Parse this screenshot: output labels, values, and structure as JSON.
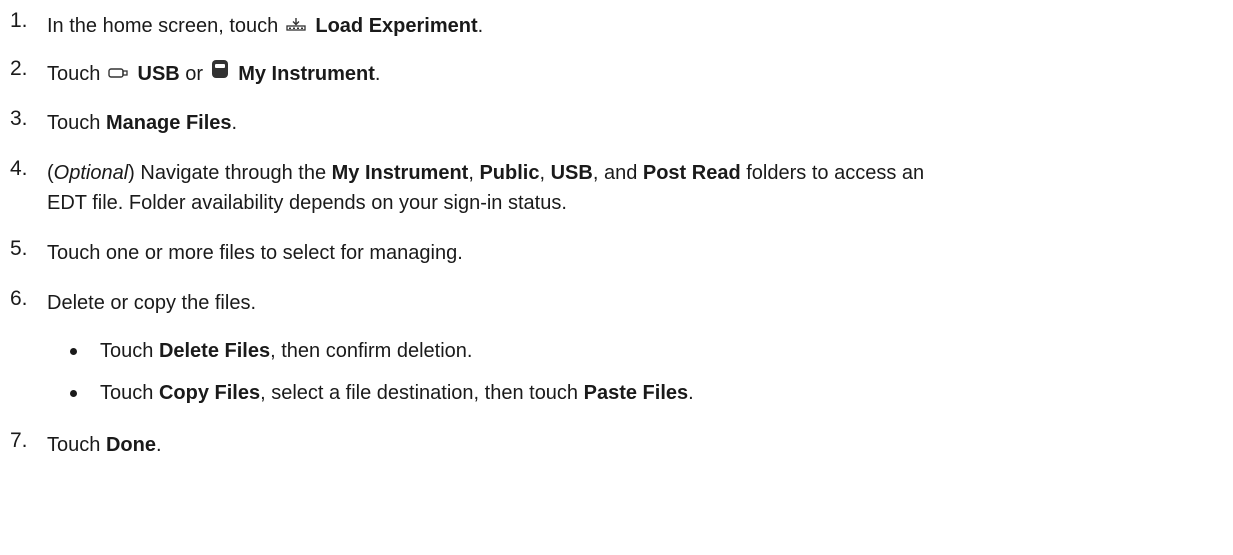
{
  "steps": [
    {
      "num": "1.",
      "pre": "In the home screen, touch",
      "icon": "load-experiment-icon",
      "bold1": "Load Experiment",
      "post": "."
    },
    {
      "num": "2.",
      "pre": "Touch",
      "icon1": "usb-icon",
      "bold1": "USB",
      "mid": "or",
      "icon2": "instrument-icon",
      "bold2": "My Instrument",
      "post": "."
    },
    {
      "num": "3.",
      "pre": "Touch",
      "bold1": "Manage Files",
      "post": "."
    },
    {
      "num": "4.",
      "open": "(",
      "ital": "Optional",
      "close": ") Navigate through the",
      "bold1": "My Instrument",
      "sep1": ",",
      "bold2": "Public",
      "sep2": ",",
      "bold3": "USB",
      "sep3": ", and",
      "bold4": "Post Read",
      "post1": "folders to access an",
      "line2": "EDT file. Folder availability depends on your sign-in status."
    },
    {
      "num": "5.",
      "text": "Touch one or more files to select for managing."
    },
    {
      "num": "6.",
      "text": "Delete or copy the files.",
      "bullets": [
        {
          "pre": "Touch",
          "bold1": "Delete Files",
          "post": ", then confirm deletion."
        },
        {
          "pre": "Touch",
          "bold1": "Copy Files",
          "mid": ", select a file destination, then touch",
          "bold2": "Paste Files",
          "post": "."
        }
      ]
    },
    {
      "num": "7.",
      "pre": "Touch",
      "bold1": "Done",
      "post": "."
    }
  ]
}
